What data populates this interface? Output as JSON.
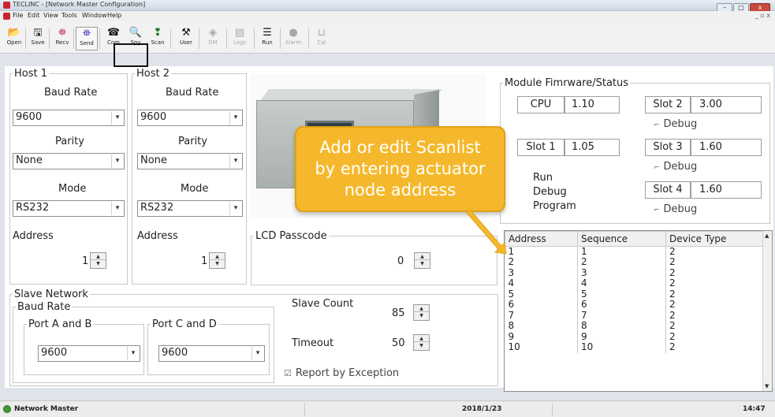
{
  "window": {
    "title": "TECLINC - [Network Master Configuration]",
    "min": "–",
    "max": "□",
    "close": "x"
  },
  "mdi_controls": "_ ▫ x",
  "menu": [
    "File",
    "Edit",
    "View",
    "Tools",
    "Window",
    "Help"
  ],
  "toolbar": [
    {
      "label": "Open",
      "icon": "folder-icon",
      "glyph": "📂"
    },
    {
      "label": "Save",
      "icon": "floppy-icon",
      "glyph": "🖫"
    },
    {
      "label": "Recv",
      "icon": "receive-icon",
      "glyph": "⛯"
    },
    {
      "label": "Send",
      "icon": "send-icon",
      "glyph": "⛯"
    },
    {
      "label": "Com",
      "icon": "phone-icon",
      "glyph": "☎"
    },
    {
      "label": "Spy",
      "icon": "magnifier-icon",
      "glyph": "🔍"
    },
    {
      "label": "Scan",
      "icon": "scan-icon",
      "glyph": "❢"
    },
    {
      "label": "User",
      "icon": "user-icon",
      "glyph": "⚒"
    },
    {
      "label": "DM",
      "icon": "dm-icon",
      "glyph": "◈"
    },
    {
      "label": "Logs",
      "icon": "logs-icon",
      "glyph": "▤"
    },
    {
      "label": "Run",
      "icon": "run-icon",
      "glyph": "☰"
    },
    {
      "label": "Alarm",
      "icon": "alarm-icon",
      "glyph": "●"
    },
    {
      "label": "Cal",
      "icon": "cal-icon",
      "glyph": "⊔"
    }
  ],
  "host1": {
    "legend": "Host 1",
    "baud_label": "Baud Rate",
    "baud": "9600",
    "parity_label": "Parity",
    "parity": "None",
    "mode_label": "Mode",
    "mode": "RS232",
    "address_label": "Address",
    "address": "1"
  },
  "host2": {
    "legend": "Host 2",
    "baud_label": "Baud Rate",
    "baud": "9600",
    "parity_label": "Parity",
    "parity": "None",
    "mode_label": "Mode",
    "mode": "RS232",
    "address_label": "Address",
    "address": "1"
  },
  "lcd": {
    "legend": "LCD Passcode",
    "value": "0"
  },
  "module": {
    "legend": "Module Fimrware/Status",
    "cpu_label": "CPU",
    "cpu": "1.10",
    "slot1_label": "Slot 1",
    "slot1": "1.05",
    "slot2_label": "Slot 2",
    "slot2": "3.00",
    "slot3_label": "Slot 3",
    "slot3": "1.60",
    "slot4_label": "Slot 4",
    "slot4": "1.60",
    "debug": "Debug",
    "run": "Run",
    "debug_radio": "Debug",
    "program": "Program"
  },
  "slave": {
    "legend": "Slave Network",
    "baud_legend": "Baud Rate",
    "port_ab": "Port A and B",
    "port_ab_val": "9600",
    "port_cd": "Port C and D",
    "port_cd_val": "9600",
    "count_label": "Slave Count",
    "count": "85",
    "timeout_label": "Timeout",
    "timeout": "50",
    "report": "Report by Exception"
  },
  "scanlist": {
    "headers": [
      "Address",
      "Sequence",
      "Device Type"
    ],
    "rows": [
      [
        "1",
        "1",
        "2"
      ],
      [
        "2",
        "2",
        "2"
      ],
      [
        "3",
        "3",
        "2"
      ],
      [
        "4",
        "4",
        "2"
      ],
      [
        "5",
        "5",
        "2"
      ],
      [
        "6",
        "6",
        "2"
      ],
      [
        "7",
        "7",
        "2"
      ],
      [
        "8",
        "8",
        "2"
      ],
      [
        "9",
        "9",
        "2"
      ],
      [
        "10",
        "10",
        "2"
      ]
    ]
  },
  "callout": {
    "line1": "Add or edit Scanlist",
    "line2": "by entering actuator",
    "line3": "node address"
  },
  "status": {
    "app": "Network Master",
    "date": "2018/1/23",
    "time": "14:47"
  },
  "colors": {
    "callout": "#f5b82c",
    "status_icon": "#3c9b36"
  }
}
